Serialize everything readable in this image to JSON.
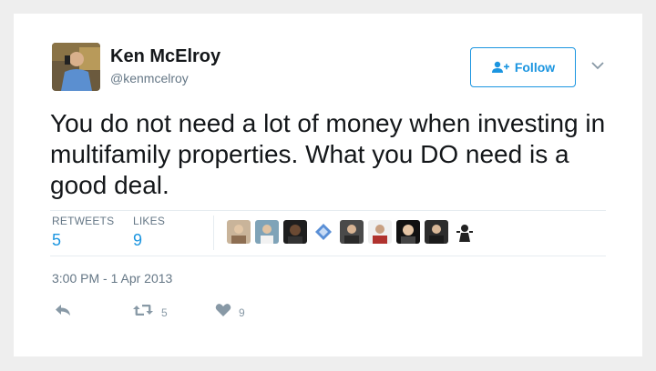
{
  "author": {
    "name": "Ken McElroy",
    "handle": "@kenmcelroy",
    "avatar_icon": "profile-photo"
  },
  "follow_button": {
    "label": "Follow",
    "icon": "add-user-icon"
  },
  "menu_icon": "chevron-down-icon",
  "tweet": {
    "text": "You do not need a lot of money when investing in multifamily properties. What you DO need is a good deal."
  },
  "stats": {
    "retweets_label": "RETWEETS",
    "retweets_value": "5",
    "likes_label": "LIKES",
    "likes_value": "9"
  },
  "likers_count": 9,
  "timestamp": "3:00 PM - 1 Apr 2013",
  "actions": {
    "reply_icon": "reply-icon",
    "retweet_icon": "retweet-icon",
    "retweet_count": "5",
    "like_icon": "heart-icon",
    "like_count": "9"
  },
  "colors": {
    "accent": "#1b95e0",
    "text": "#14171a",
    "muted": "#657786",
    "background": "#eeeeee",
    "card": "#ffffff"
  }
}
